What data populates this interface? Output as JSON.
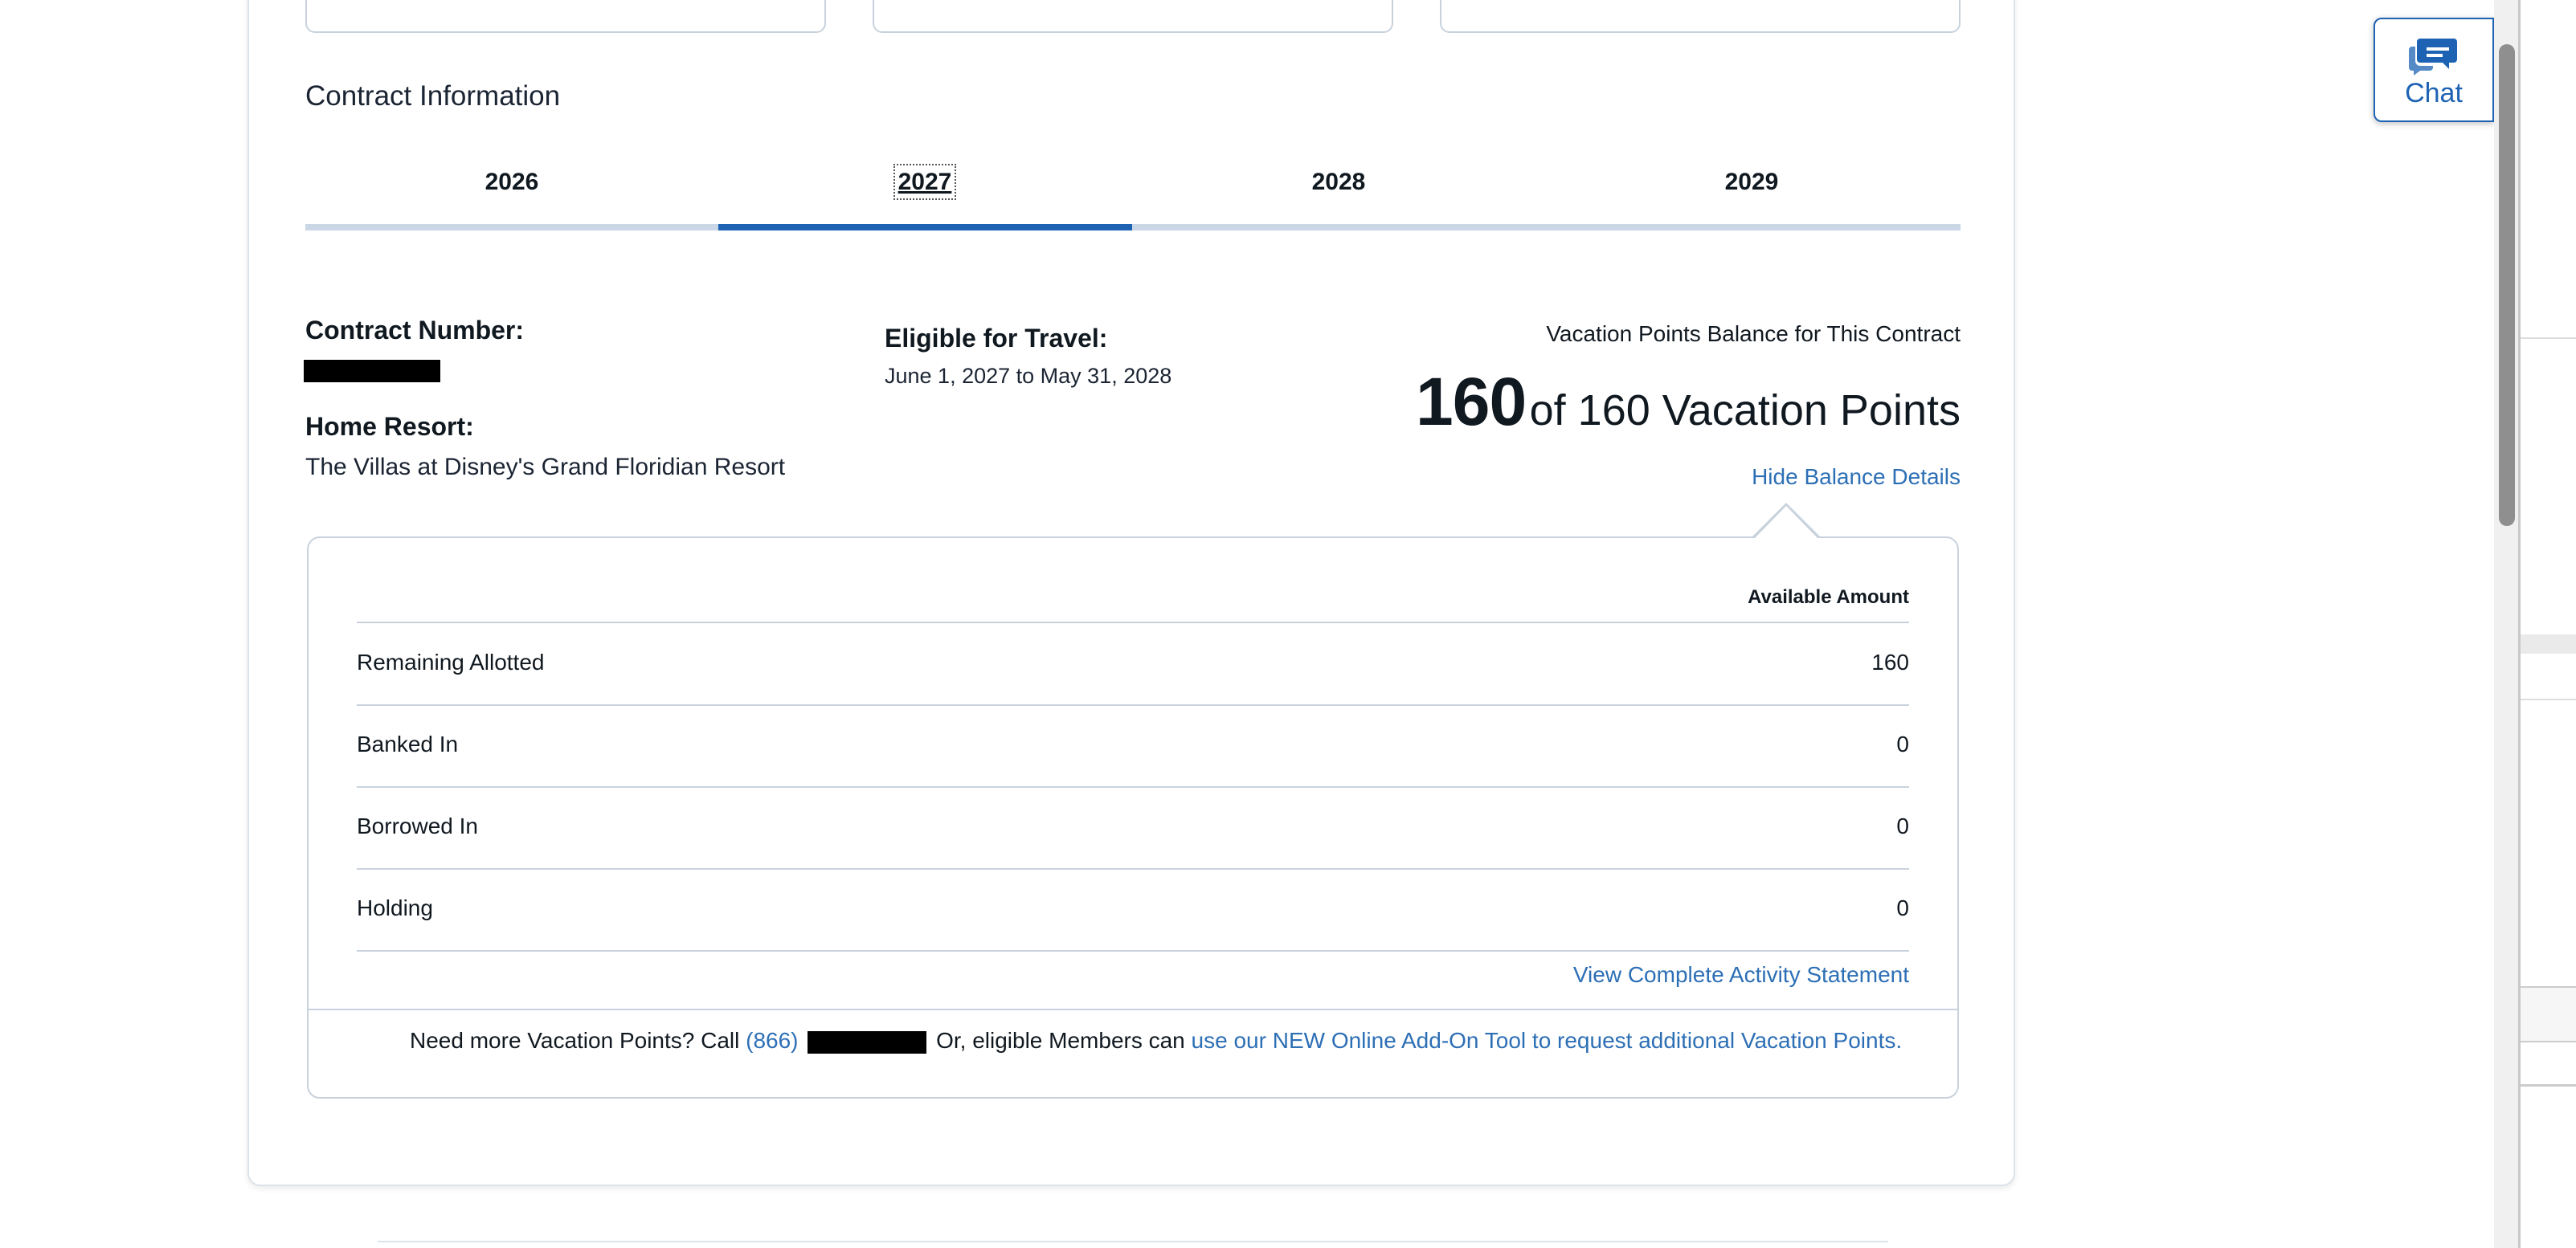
{
  "section": {
    "title": "Contract Information"
  },
  "tabs": [
    {
      "label": "2026",
      "active": false
    },
    {
      "label": "2027",
      "active": true
    },
    {
      "label": "2028",
      "active": false
    },
    {
      "label": "2029",
      "active": false
    }
  ],
  "contract": {
    "number_label": "Contract Number:",
    "home_resort_label": "Home Resort:",
    "home_resort": "The Villas at Disney's Grand Floridian Resort",
    "travel_label": "Eligible for Travel:",
    "travel_dates": "June 1, 2027 to May 31, 2028"
  },
  "balance": {
    "caption": "Vacation Points Balance for This Contract",
    "current": "160",
    "of_text": "of 160 Vacation Points",
    "hide_link": "Hide Balance Details"
  },
  "details": {
    "column_header": "Available Amount",
    "rows": [
      {
        "name": "Remaining Allotted",
        "amount": "160"
      },
      {
        "name": "Banked In",
        "amount": "0"
      },
      {
        "name": "Borrowed In",
        "amount": "0"
      },
      {
        "name": "Holding",
        "amount": "0"
      }
    ],
    "statement_link": "View Complete Activity Statement"
  },
  "footer": {
    "prefix": "Need more Vacation Points? Call ",
    "phone_area": "(866)",
    "middle": " Or, eligible Members can ",
    "link": "use our NEW Online Add-On Tool to request additional Vacation Points."
  },
  "chat": {
    "label": "Chat",
    "icon": "chat-bubble-icon",
    "color": "#1e63b3"
  },
  "colors": {
    "accent": "#1e63b3",
    "link": "#2d6fb5",
    "track": "#c9d7e6"
  }
}
